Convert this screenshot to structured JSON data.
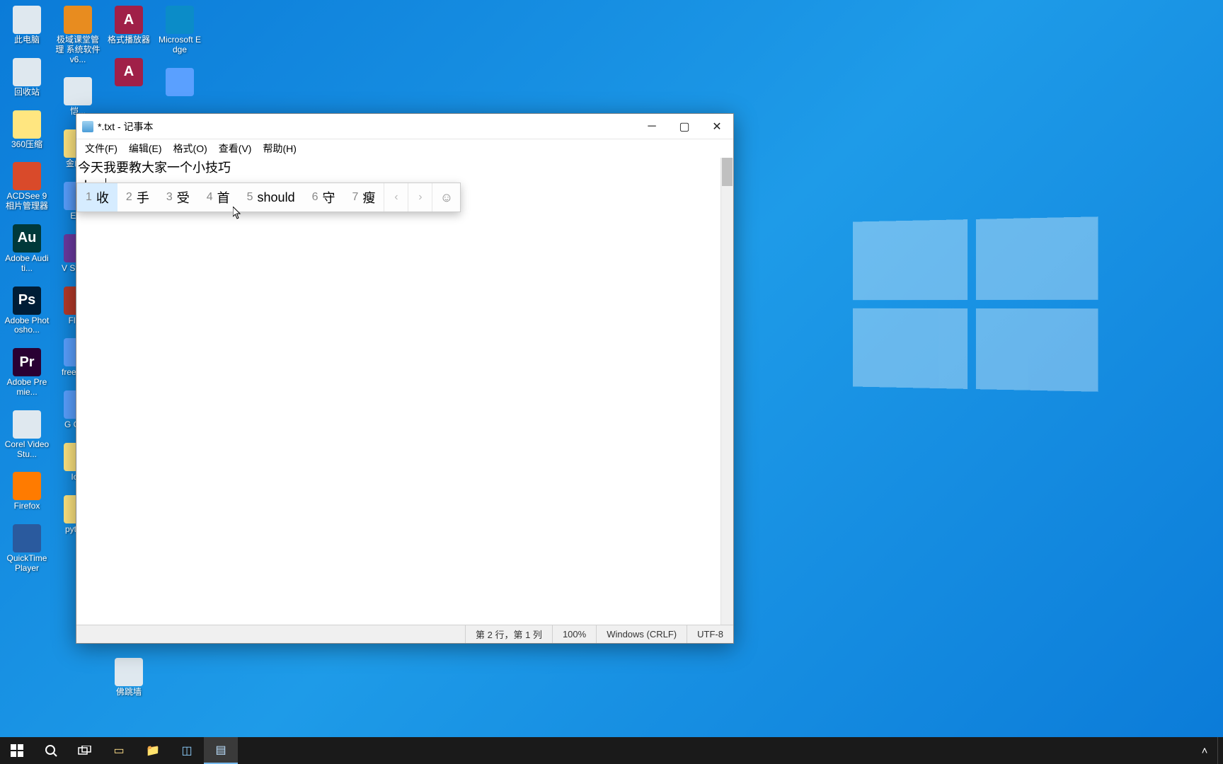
{
  "desktop_icons_col1": [
    {
      "label": "此电脑",
      "bg": "#dfe8ef"
    },
    {
      "label": "回收站",
      "bg": "#dfe8ef"
    },
    {
      "label": "360压缩",
      "bg": "#ffe680"
    },
    {
      "label": "ACDSee 9\n相片管理器",
      "bg": "#d94a2a"
    },
    {
      "label": "Adobe\nAuditi...",
      "bg": "#00393a",
      "txt": "Au"
    },
    {
      "label": "Adobe\nPhotosho...",
      "bg": "#001d36",
      "txt": "Ps"
    },
    {
      "label": "Adobe\nPremie...",
      "bg": "#2a0033",
      "txt": "Pr"
    },
    {
      "label": "Corel\nVideoStu...",
      "bg": "#dfe8ef"
    },
    {
      "label": "Firefox",
      "bg": "#ff7b00"
    },
    {
      "label": "QuickTime\nPlayer",
      "bg": "#2a5a9e"
    }
  ],
  "desktop_icons_col2": [
    {
      "label": "极域课堂管理\n系统软件v6...",
      "bg": "#e88c1f"
    },
    {
      "label": "恺...",
      "bg": "#dfe8ef"
    },
    {
      "label": "金山...",
      "bg": "#ffe680"
    },
    {
      "label": "E\\...",
      "bg": "#5aa0ff"
    },
    {
      "label": "V\nStud...",
      "bg": "#6b3aa0"
    },
    {
      "label": "Fla...",
      "bg": "#b43a2a"
    },
    {
      "label": "free\n快...",
      "bg": "#5aa0ff"
    },
    {
      "label": "G\nCh...",
      "bg": "#5aa0ff"
    },
    {
      "label": "Ic...",
      "bg": "#ffe680"
    },
    {
      "label": "python",
      "bg": "#ffe680"
    }
  ],
  "desktop_icons_col3": [
    {
      "label": "格式播放器",
      "bg": "#a02048",
      "txt": "A"
    },
    {
      "label": "",
      "bg": "#a02048",
      "txt": "A"
    }
  ],
  "desktop_icons_col4": [
    {
      "label": "Microsoft\nEdge",
      "bg": "#0b8cc8"
    },
    {
      "label": "",
      "bg": "#5aa0ff"
    }
  ],
  "desktop_icons_row_bottom": {
    "label": "佛跳墙",
    "bg": "#dfe8ef"
  },
  "notepad": {
    "title": "*.txt - 记事本",
    "menus": [
      "文件(F)",
      "编辑(E)",
      "格式(O)",
      "查看(V)",
      "帮助(H)"
    ],
    "line1": "今天我要教大家一个小技巧",
    "typed": "shou",
    "status": {
      "pos": "第 2 行，第 1 列",
      "zoom": "100%",
      "eol": "Windows (CRLF)",
      "enc": "UTF-8"
    }
  },
  "ime": {
    "candidates": [
      {
        "n": "1",
        "t": "收"
      },
      {
        "n": "2",
        "t": "手"
      },
      {
        "n": "3",
        "t": "受"
      },
      {
        "n": "4",
        "t": "首"
      },
      {
        "n": "5",
        "t": "should"
      },
      {
        "n": "6",
        "t": "守"
      },
      {
        "n": "7",
        "t": "瘦"
      }
    ]
  },
  "taskbar": {
    "start": "⊞"
  }
}
